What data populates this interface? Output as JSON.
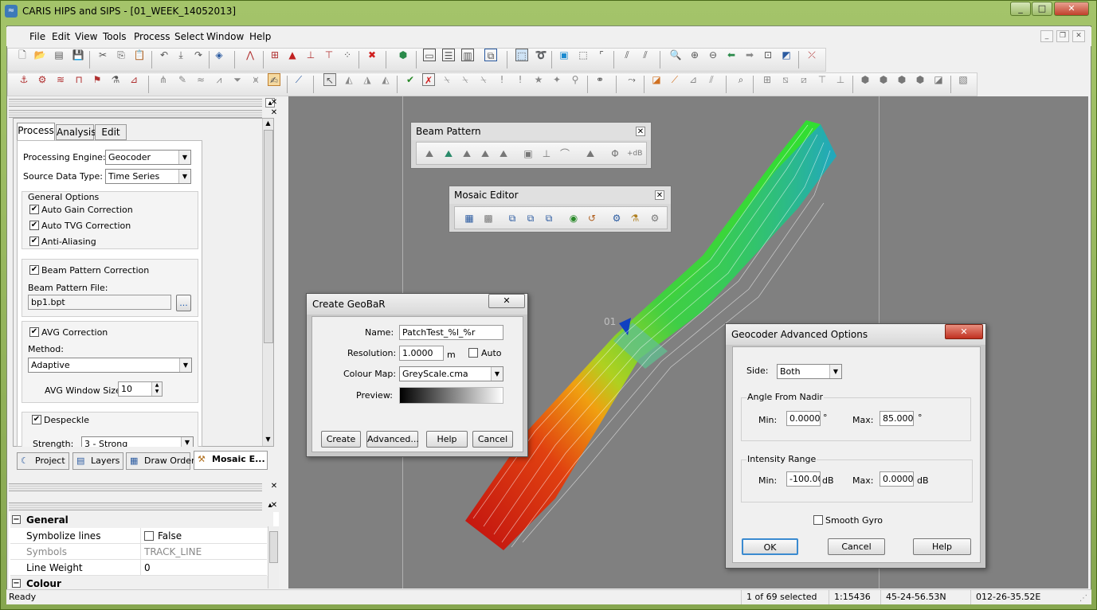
{
  "window": {
    "title": "CARIS HIPS and SIPS - [01_WEEK_14052013]",
    "minimize": "_",
    "maximize": "□",
    "close": "✕"
  },
  "menubar": {
    "items": [
      "File",
      "Edit",
      "View",
      "Tools",
      "Process",
      "Select",
      "Window",
      "Help"
    ]
  },
  "left_panel": {
    "tabs": [
      "Process",
      "Analysis",
      "Edit"
    ],
    "processing_engine_label": "Processing Engine:",
    "processing_engine_value": "Geocoder",
    "source_data_type_label": "Source Data Type:",
    "source_data_type_value": "Time Series",
    "general_options_label": "General Options",
    "auto_gain": "Auto Gain Correction",
    "auto_tvg": "Auto TVG Correction",
    "anti_aliasing": "Anti-Aliasing",
    "beam_pattern_correction": "Beam Pattern Correction",
    "beam_pattern_file_label": "Beam Pattern File:",
    "beam_pattern_file_value": "bp1.bpt",
    "browse": "...",
    "avg_correction": "AVG Correction",
    "method_label": "Method:",
    "method_value": "Adaptive",
    "avg_window_label": "AVG Window Size:",
    "avg_window_value": "10",
    "despeckle": "Despeckle",
    "strength_label": "Strength:",
    "strength_value": "3 - Strong",
    "bottom_tabs": [
      "Project",
      "Layers",
      "Draw Order",
      "Mosaic E..."
    ]
  },
  "properties": {
    "general_header": "General",
    "rows": [
      {
        "key": "Symbolize lines",
        "value": "False"
      },
      {
        "key": "Symbols",
        "value": "TRACK_LINE"
      },
      {
        "key": "Line Weight",
        "value": "0"
      }
    ],
    "colour_header": "Colour"
  },
  "beam_pattern_toolbar": {
    "title": "Beam Pattern"
  },
  "mosaic_editor_toolbar": {
    "title": "Mosaic Editor"
  },
  "map": {
    "line_label": "01"
  },
  "create_geobar": {
    "title": "Create GeoBaR",
    "name_label": "Name:",
    "name_value": "PatchTest_%l_%r",
    "resolution_label": "Resolution:",
    "resolution_value": "1.0000",
    "resolution_unit": "m",
    "auto_label": "Auto",
    "colour_map_label": "Colour Map:",
    "colour_map_value": "GreyScale.cma",
    "preview_label": "Preview:",
    "buttons": [
      "Create",
      "Advanced...",
      "Help",
      "Cancel"
    ]
  },
  "geocoder_advanced": {
    "title": "Geocoder Advanced Options",
    "side_label": "Side:",
    "side_value": "Both",
    "angle_group": "Angle From Nadir",
    "min_label": "Min:",
    "max_label": "Max:",
    "angle_min": "0.0000",
    "angle_max": "85.0000",
    "deg": "°",
    "intensity_group": "Intensity Range",
    "int_min": "-100.00",
    "int_max": "0.0000",
    "db": "dB",
    "smooth_gyro": "Smooth Gyro",
    "buttons": [
      "OK",
      "Cancel",
      "Help"
    ]
  },
  "status": {
    "ready": "Ready",
    "selected": "1 of 69 selected",
    "scale": "1:15436",
    "lat": "45-24-56.53N",
    "lon": "012-26-35.52E"
  }
}
